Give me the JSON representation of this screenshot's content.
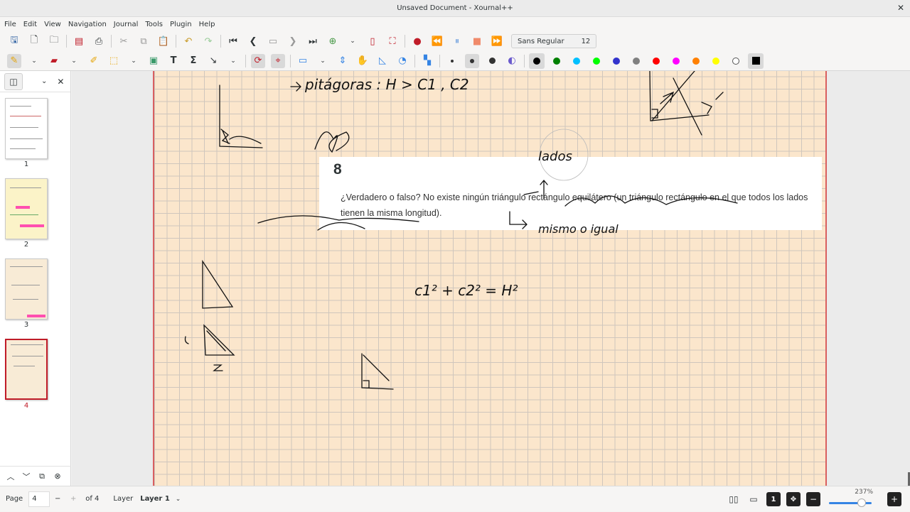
{
  "window": {
    "title": "Unsaved Document - Xournal++"
  },
  "menu": [
    "File",
    "Edit",
    "View",
    "Navigation",
    "Journal",
    "Tools",
    "Plugin",
    "Help"
  ],
  "font_selector": {
    "font": "Sans Regular",
    "size": "12"
  },
  "colors": {
    "palette": [
      "#000000",
      "#008000",
      "#00c0ff",
      "#00ff00",
      "#3333cc",
      "#808080",
      "#ff0000",
      "#ff00ff",
      "#ff8000",
      "#ffff00",
      "#ffffff",
      "#000000"
    ],
    "page_background": "#fbe6cc",
    "selected_thumb": "#c01c28"
  },
  "sidebar": {
    "pages": [
      {
        "number": "1"
      },
      {
        "number": "2"
      },
      {
        "number": "3"
      },
      {
        "number": "4"
      }
    ]
  },
  "document": {
    "question_number": "8",
    "question_text": "¿Verdadero o falso? No existe ningún triángulo rectángulo equilátero (un triángulo rectángulo en el que todos los lados tienen la misma longitud).",
    "notes": {
      "pitagoras": "pitágoras  :  H > C1 , C2",
      "lados": "lados",
      "mismo": "mismo o igual",
      "formula": "c1² + c2² = H²"
    }
  },
  "statusbar": {
    "page_label": "Page",
    "page_value": "4",
    "page_total": "of 4",
    "layer_label": "Layer",
    "layer_value": "Layer 1",
    "zoom": "237%"
  }
}
